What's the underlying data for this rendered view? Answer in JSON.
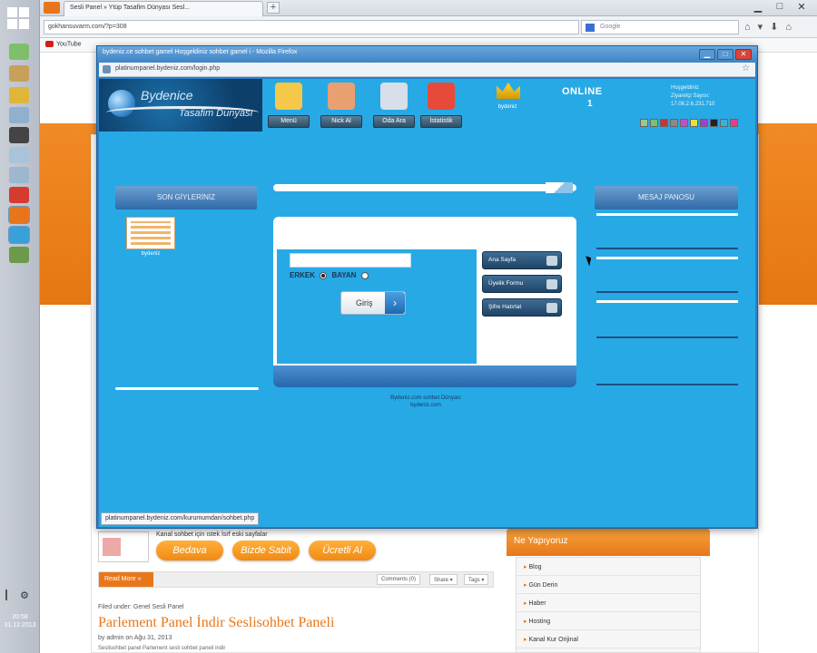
{
  "taskbar": {
    "clock": "20:58",
    "date": "31.12.2013"
  },
  "browser": {
    "tab_title": "Sesli Panel » Ytüp Tasafim Dünyası Sesl...",
    "new_tab": "+",
    "url": "gokhansuvarm.com/?p=308",
    "search_placeholder": "Google",
    "bookmark": "YouTube"
  },
  "popup": {
    "title": "bydeniz.ce sohbet gamel Hoşgeldiniz sohbet gamel i - Mozilla Firefox",
    "url": "platinumpanel.bydeniz.com/login.php",
    "status_url": "platinumpanel.bydeniz.com/kurumumdan/sohbet.php"
  },
  "site": {
    "logo_name": "Bydenice",
    "logo_sub": "Tasafim Dunyası",
    "nav": [
      {
        "label": "Menü",
        "color": "#f6c84a"
      },
      {
        "label": "Nick Al",
        "color": "#e8a070"
      },
      {
        "label": "Oda Ara",
        "color": "#d8dfe8"
      },
      {
        "label": "İstatistik",
        "color": "#e84a3a"
      }
    ],
    "crown_user": "bydeniz",
    "online_label": "ONLINE",
    "online_count": "1",
    "info": [
      "Hoşgeldiniz",
      "Ziyaretçi Sayısı:",
      "17.06.2.6.231.710"
    ],
    "theme_colors": [
      "#9fc58b",
      "#7fbf6a",
      "#c33",
      "#8a8a8a",
      "#c050c8",
      "#e6e040",
      "#a040d0",
      "#222",
      "#3ab0d8",
      "#e0408a"
    ],
    "left_panel_title": "SON GİYLERİNİZ",
    "left_user": "bydeniz",
    "gender_male": "ERKEK",
    "gender_female": "BAYAN",
    "login_button": "Giriş",
    "side_buttons": [
      "Ana Sayfa",
      "Üyelik Formu",
      "Şifre Hatırlat"
    ],
    "right_panel_title": "MESAJ PANOSU",
    "footer_line1": "Bydeniz.com sohbet Dünyası",
    "footer_line2": "bydeniz.com"
  },
  "bgpage": {
    "desc": "Kanal sohbet için ıstek İsrf eski sayfalar",
    "buttons": [
      "Bedava",
      "Bizde Sabit",
      "Ücretli Al"
    ],
    "widget_title": "Ne Yapıyoruz",
    "widget_items": [
      "Blog",
      "Gün Derin",
      "Haber",
      "Hosting",
      "Kanal Kur Orijinal"
    ],
    "read_more": "Read More »",
    "pills": [
      "Comments (0)",
      "Share ▾",
      "Tags ▾"
    ],
    "crumb": "Filed under: Genel Sesli Panel",
    "post_title": "Parlement Panel İndir Seslisohbet Paneli",
    "post_meta": "by admin on Ağu 31, 2013",
    "post_text": "Seslisohbet panel Parlement sesli sohbet paneli indir"
  }
}
